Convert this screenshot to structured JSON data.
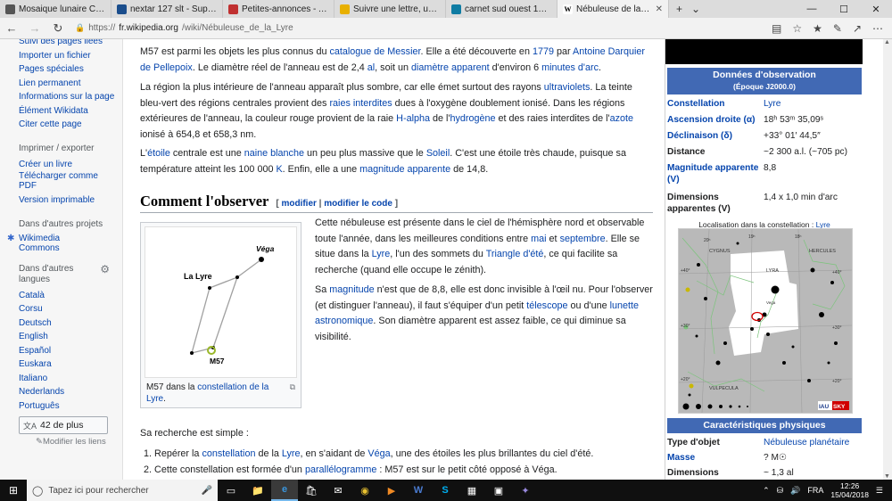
{
  "browser": {
    "tabs": [
      {
        "title": "Mosaique lunaire C11 asi224",
        "favicon": "forum-icon",
        "color": "#555"
      },
      {
        "title": "nextar 127 slt - Support déb",
        "favicon": "forum-icon",
        "color": "#1a4d8c"
      },
      {
        "title": "Petites-annonces - Astrosurf",
        "favicon": "ads-icon",
        "color": "#c03030"
      },
      {
        "title": "Suivre une lettre, un Colissim",
        "favicon": "post-icon",
        "color": "#e8b000"
      },
      {
        "title": "carnet sud ouest 17 - Bing",
        "favicon": "bing-icon",
        "color": "#0f7ca3"
      },
      {
        "title": "Nébuleuse de la Lyre —",
        "favicon": "wikipedia-icon",
        "color": "#fff",
        "active": true
      }
    ],
    "url_prefix": "https://",
    "url_domain": "fr.wikipedia.org",
    "url_path": "/wiki/Nébuleuse_de_la_Lyre"
  },
  "sidebar": {
    "top_links": [
      "Suivi des pages liées",
      "Importer un fichier",
      "Pages spéciales",
      "Lien permanent",
      "Informations sur la page",
      "Élément Wikidata",
      "Citer cette page"
    ],
    "print_head": "Imprimer / exporter",
    "print_links": [
      "Créer un livre",
      "Télécharger comme",
      "PDF",
      "Version imprimable"
    ],
    "projects_head": "Dans d'autres projets",
    "projects_links": [
      "Wikimedia",
      "Commons"
    ],
    "lang_head_1": "Dans d'autres",
    "lang_head_2": "langues",
    "languages": [
      "Català",
      "Corsu",
      "Deutsch",
      "English",
      "Español",
      "Euskara",
      "Italiano",
      "Nederlands",
      "Português"
    ],
    "more_label": "42 de plus",
    "edit_links": "Modifier les liens"
  },
  "article": {
    "p1": {
      "t1": "M57 est parmi les objets les plus connus du ",
      "l1": "catalogue de Messier",
      "t2": ". Elle a été découverte en ",
      "l2": "1779",
      "t3": " par ",
      "l3": "Antoine Darquier de Pellepoix",
      "t4": ". Le diamètre réel de l'anneau est de 2,4 ",
      "l4": "al",
      "t5": ", soit un ",
      "l5": "diamètre apparent",
      "t6": " d'environ 6 ",
      "l6": "minutes d'arc",
      "t7": "."
    },
    "p2": {
      "t1": "La région la plus intérieure de l'anneau apparaît plus sombre, car elle émet surtout des rayons ",
      "l1": "ultraviolets",
      "t2": ". La teinte bleu-vert des régions centrales provient des ",
      "l2": "raies interdites",
      "t3": " dues à l'oxygène doublement ionisé. Dans les régions extérieures de l'anneau, la couleur rouge provient de la raie ",
      "l3": "H-alpha",
      "t4": " de l'",
      "l4": "hydrogène",
      "t5": " et des raies interdites de l'",
      "l5": "azote",
      "t6": " ionisé à 654,8 et 658,3 nm."
    },
    "p3": {
      "t1": "L'",
      "l1": "étoile",
      "t2": " centrale est une ",
      "l2": "naine blanche",
      "t3": " un peu plus massive que le ",
      "l3": "Soleil",
      "t4": ". C'est une étoile très chaude, puisque sa température atteint les 100 000 ",
      "l4": "K",
      "t5": ". Enfin, elle a une ",
      "l5": "magnitude apparente",
      "t6": " de 14,8."
    },
    "section_title": "Comment l'observer",
    "section_edit_open": "[ ",
    "section_edit_1": "modifier",
    "section_edit_sep": " | ",
    "section_edit_2": "modifier le code",
    "section_edit_close": " ]",
    "figure": {
      "label_vega": "Véga",
      "label_lyre": "La Lyre",
      "label_m57": "M57",
      "caption_t1": "M57 dans la ",
      "caption_l1": "constellation de la Lyre",
      "caption_t2": "."
    },
    "p4": {
      "t1": "Cette nébuleuse est présente dans le ciel de l'hémisphère nord et observable toute l'année, dans les meilleures conditions entre ",
      "l1": "mai",
      "t2": " et ",
      "l2": "septembre",
      "t3": ". Elle se situe dans la ",
      "l3": "Lyre",
      "t4": ", l'un des sommets du ",
      "l4": "Triangle d'été",
      "t5": ", ce qui facilite sa recherche (quand elle occupe le zénith)."
    },
    "p5": {
      "t1": "Sa ",
      "l1": "magnitude",
      "t2": " n'est que de 8,8, elle est donc invisible à l'œil nu. Pour l'observer (et distinguer l'anneau), il faut s'équiper d'un petit ",
      "l2": "télescope",
      "t3": " ou d'une ",
      "l3": "lunette astronomique",
      "t4": ". Son diamètre apparent est assez faible, ce qui diminue sa visibilité."
    },
    "p6": "Sa recherche est simple :",
    "list": [
      {
        "num": "1.",
        "t1": "Repérer la ",
        "l1": "constellation",
        "t2": " de la ",
        "l2": "Lyre",
        "t3": ", en s'aidant de ",
        "l3": "Véga",
        "t4": ", une des étoiles les plus brillantes du ciel d'été."
      },
      {
        "num": "2.",
        "t1": "Cette constellation est formée d'un ",
        "l1": "parallélogramme",
        "t2": " : M57 est sur le petit côté opposé à Véga.",
        "l2": "",
        "t3": "",
        "l3": "",
        "t4": ""
      }
    ]
  },
  "infobox": {
    "header": "Données d'observation",
    "header_sub": "(Époque J2000.0)",
    "rows": [
      {
        "k": "Constellation",
        "v": "Lyre",
        "klink": true,
        "vlink": true
      },
      {
        "k": "Ascension droite (α)",
        "v": "18ʰ 53ᵐ 35,09ˢ",
        "klink": true,
        "vlink": false
      },
      {
        "k": "Déclinaison (δ)",
        "v": "+33° 01′ 44,5″",
        "klink": true,
        "vlink": false
      },
      {
        "k": "Distance",
        "v": "~2 300 a.l. (~705 pc)",
        "klink": false,
        "vlink": false
      },
      {
        "k": "Magnitude apparente (V)",
        "v": "8,8",
        "klink": true,
        "vlink": false
      },
      {
        "k": "Dimensions apparentes (V)",
        "v": "1,4 x 1,0 min d'arc",
        "klink": false,
        "vlink": false
      }
    ],
    "loc_label": "Localisation dans la constellation : ",
    "loc_link": "Lyre",
    "map_labels": {
      "cygnus": "CYGNUS",
      "hercules": "HERCULES",
      "lyra": "LYRA",
      "vulpecula": "VULPECULA",
      "vega": "Vega",
      "ra1": "20ʰ",
      "ra2": "19ʰ",
      "ra3": "18ʰ",
      "d40": "+40°",
      "d30": "+30°",
      "d20": "+20°",
      "brand_iau": "IAU",
      "brand_sky": "SKY"
    },
    "header2": "Caractéristiques physiques",
    "rows2": [
      {
        "k": "Type d'objet",
        "v": "Nébuleuse planétaire",
        "klink": false,
        "vlink": true
      },
      {
        "k": "Masse",
        "v": "? M☉",
        "klink": true,
        "vlink": false
      },
      {
        "k": "Dimensions",
        "v": "~ 1,3 al",
        "klink": false,
        "vlink": false
      }
    ]
  },
  "taskbar": {
    "search_placeholder": "Tapez ici pour rechercher",
    "lang": "FRA",
    "time": "12:26",
    "date": "15/04/2018"
  },
  "colors": {
    "link": "#0645ad",
    "infobox_header": "#4169b4",
    "taskbar": "#101010"
  }
}
